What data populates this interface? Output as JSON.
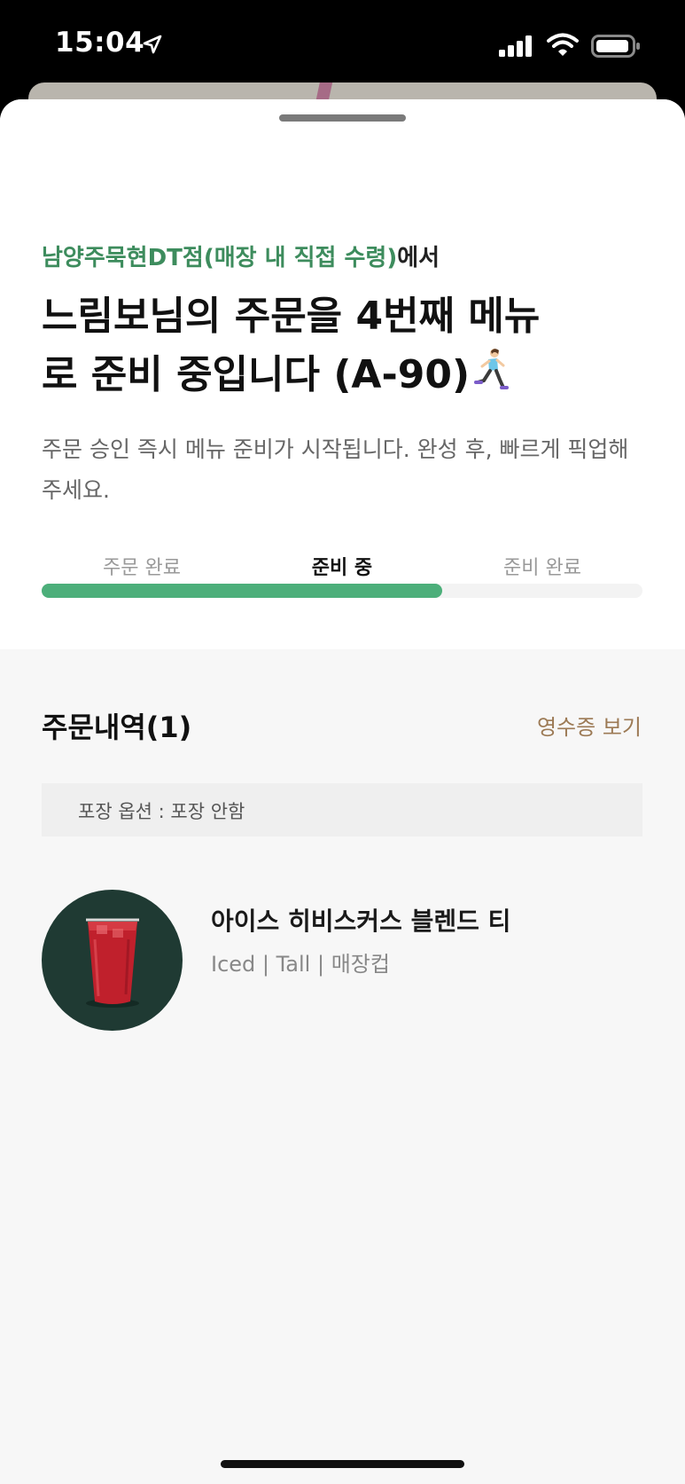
{
  "status_bar": {
    "time": "15:04"
  },
  "order_status": {
    "store_name": "남양주묵현DT점(매장 내 직접 수령)",
    "store_suffix": "에서",
    "headline_line1": "느림보님의 주문을 4번째 메뉴",
    "headline_line2": "로 준비 중입니다 (A-90)",
    "description": "주문 승인 즉시 메뉴 준비가 시작됩니다. 완성 후, 빠르게 픽업해 주세요.",
    "steps": [
      "주문 완료",
      "준비 중",
      "준비 완료"
    ],
    "active_step": 1,
    "progress_fraction": 0.667
  },
  "order_details": {
    "title": "주문내역(1)",
    "receipt_link": "영수증 보기",
    "pack_option": "포장 옵션 : 포장 안함",
    "items": [
      {
        "name": "아이스 히비스커스 블렌드 티",
        "options": "Iced | Tall | 매장컵"
      }
    ]
  },
  "colors": {
    "accent_green": "#3d8c5d",
    "progress_green": "#4caf7a",
    "link_brown": "#9c7a55"
  }
}
